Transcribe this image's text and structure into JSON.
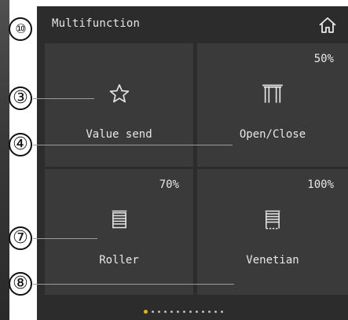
{
  "header": {
    "title": "Multifunction",
    "home_icon": "home-icon"
  },
  "tiles": [
    {
      "label": "Value send",
      "percent": "",
      "icon": "star-icon"
    },
    {
      "label": "Open/Close",
      "percent": "50%",
      "icon": "curtain-icon"
    },
    {
      "label": "Roller",
      "percent": "70%",
      "icon": "roller-shutter-icon"
    },
    {
      "label": "Venetian",
      "percent": "100%",
      "icon": "venetian-blind-icon"
    }
  ],
  "pager": {
    "total_pages": 13,
    "current_page": 1
  },
  "callouts": [
    "⑩",
    "③",
    "④",
    "⑦",
    "⑧"
  ],
  "colors": {
    "panel": "#2c2c2c",
    "tile": "#3a3a3a",
    "text": "#e8e8e8"
  }
}
